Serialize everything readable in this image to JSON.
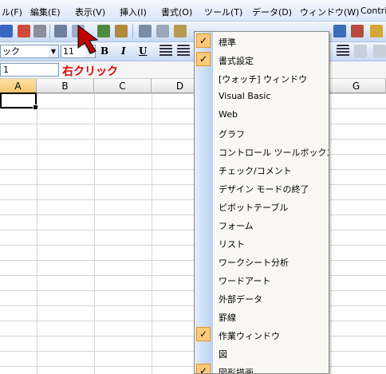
{
  "menubar": {
    "items": [
      "ル(F)",
      "編集(E)",
      "表示(V)",
      "挿入(I)",
      "書式(O)",
      "ツール(T)",
      "データ(D)",
      "ウィンドウ(W)",
      "Contri"
    ]
  },
  "toolbar": {
    "font_name": "ック",
    "font_size": "11",
    "bold": "B",
    "italic": "I",
    "underline": "U",
    "sigma": "Σ"
  },
  "formula_bar": {
    "name_box": "1",
    "annotation": "右クリック"
  },
  "columns": [
    "A",
    "B",
    "C",
    "D",
    "G"
  ],
  "context_menu": {
    "items": [
      {
        "label": "標準",
        "checked": true
      },
      {
        "label": "書式設定",
        "checked": true
      },
      {
        "label": "[ウォッチ] ウィンドウ",
        "checked": false
      },
      {
        "label": "Visual Basic",
        "checked": false
      },
      {
        "label": "Web",
        "checked": false
      },
      {
        "label": "グラフ",
        "checked": false
      },
      {
        "label": "コントロール ツールボックス",
        "checked": false
      },
      {
        "label": "チェック/コメント",
        "checked": false
      },
      {
        "label": "デザイン モードの終了",
        "checked": false
      },
      {
        "label": "ピボットテーブル",
        "checked": false
      },
      {
        "label": "フォーム",
        "checked": false
      },
      {
        "label": "リスト",
        "checked": false
      },
      {
        "label": "ワークシート分析",
        "checked": false
      },
      {
        "label": "ワードアート",
        "checked": false
      },
      {
        "label": "外部データ",
        "checked": false
      },
      {
        "label": "罫線",
        "checked": false
      },
      {
        "label": "作業ウィンドウ",
        "checked": true
      },
      {
        "label": "図",
        "checked": false
      },
      {
        "label": "図形描画",
        "checked": true
      }
    ],
    "check_glyph": "✓"
  },
  "colors": {
    "annotation": "#e00000",
    "arrow": "#c00000",
    "check_bg": "#ffc97a"
  }
}
